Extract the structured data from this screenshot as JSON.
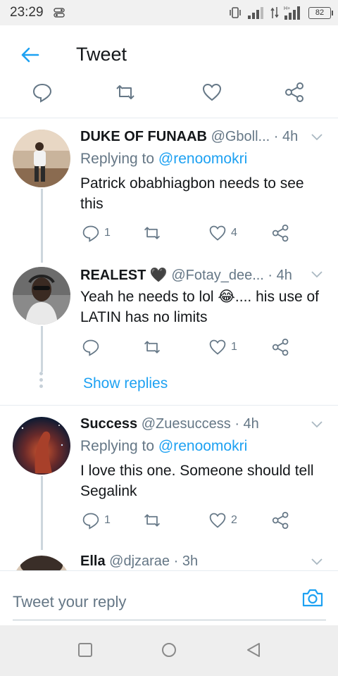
{
  "status": {
    "time": "23:29",
    "battery": "82"
  },
  "header": {
    "title": "Tweet"
  },
  "replies": [
    {
      "name": "DUKE OF FUNAAB",
      "handle": "@Gboll...",
      "time": "· 4h",
      "replying_to_label": "Replying to",
      "replying_to": "@renoomokri",
      "text": "Patrick obabhiagbon needs to see this",
      "reply_count": "1",
      "like_count": "4"
    },
    {
      "name": "REALEST 🖤",
      "handle": "@Fotay_dee...",
      "time": "· 4h",
      "text": "Yeah he needs to lol 😂.... his use of LATIN has no limits",
      "reply_count": "",
      "like_count": "1",
      "show_replies": "Show replies"
    },
    {
      "name": "Success",
      "handle": "@Zuesuccess",
      "time": "· 4h",
      "replying_to_label": "Replying to",
      "replying_to": "@renoomokri",
      "text": "I love this one. Someone should tell Segalink",
      "reply_count": "1",
      "like_count": "2"
    },
    {
      "name": "Ella",
      "handle": "@djzarae",
      "time": "· 3h"
    }
  ],
  "composer": {
    "placeholder": "Tweet your reply"
  },
  "colors": {
    "accent": "#1da1f2",
    "secondary_text": "#657786",
    "divider": "#e6ecf0"
  },
  "icons": [
    "back-arrow-icon",
    "reply-icon",
    "retweet-icon",
    "like-icon",
    "share-icon",
    "chevron-down-icon",
    "camera-icon",
    "nav-recents-icon",
    "nav-home-icon",
    "nav-back-icon"
  ]
}
